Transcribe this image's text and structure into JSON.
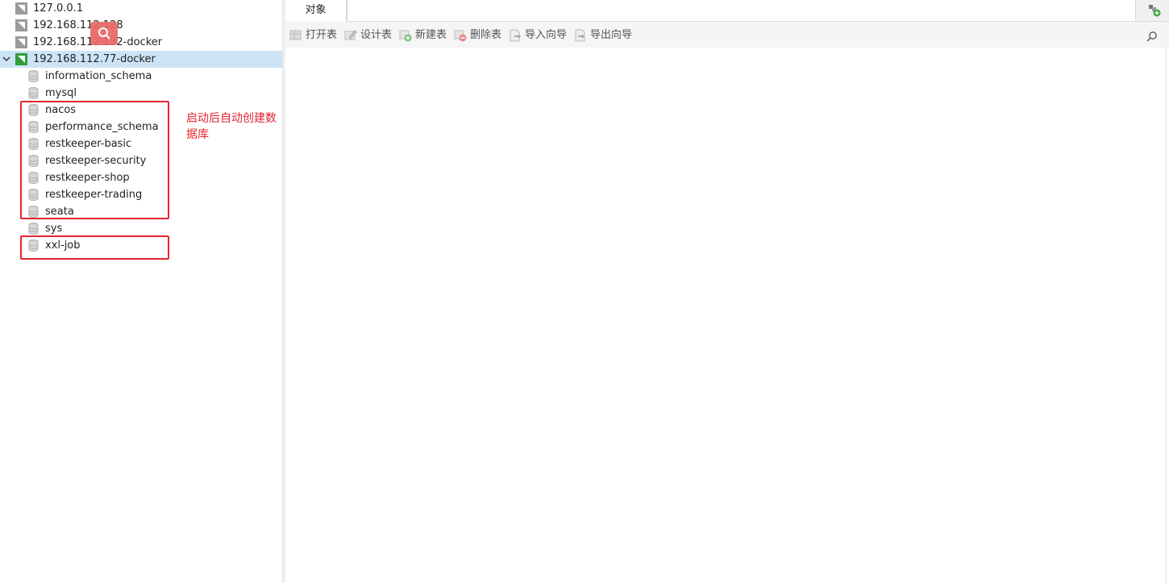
{
  "tree": {
    "connections": [
      {
        "label": "127.0.0.1",
        "expanded": false,
        "active": false
      },
      {
        "label": "192.168.112.128",
        "expanded": false,
        "active": false
      },
      {
        "label": "192.168.112.132-docker",
        "expanded": false,
        "active": false
      },
      {
        "label": "192.168.112.77-docker",
        "expanded": true,
        "active": true
      }
    ],
    "databases": [
      "information_schema",
      "mysql",
      "nacos",
      "performance_schema",
      "restkeeper-basic",
      "restkeeper-security",
      "restkeeper-shop",
      "restkeeper-trading",
      "seata",
      "sys",
      "xxl-job"
    ]
  },
  "annotation": {
    "note": "启动后自动创建数据库",
    "color": "#e3262e"
  },
  "tabs": [
    {
      "label": "对象",
      "active": true
    }
  ],
  "toolbar": {
    "open_table": "打开表",
    "design_table": "设计表",
    "new_table": "新建表",
    "delete_table": "删除表",
    "import_wizard": "导入向导",
    "export_wizard": "导出向导"
  },
  "icons": {
    "connection": "mysql-connection-icon",
    "database": "database-icon",
    "search": "search-icon",
    "new-tab": "add-tab-icon"
  },
  "colors": {
    "selection": "#cce4f7",
    "active_connection": "#2e9e3c",
    "highlight": "#e3262e"
  }
}
